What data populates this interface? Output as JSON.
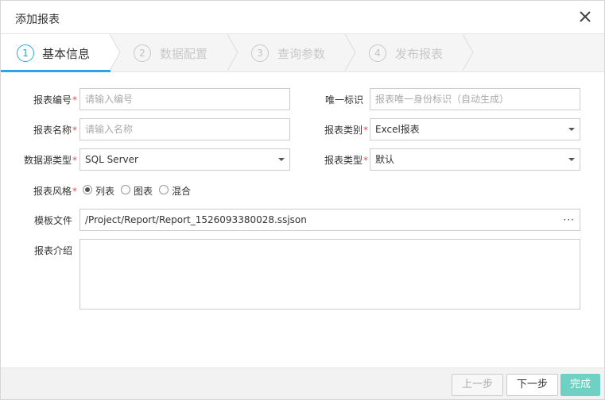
{
  "dialog": {
    "title": "添加报表",
    "close_icon": "close-icon"
  },
  "steps": [
    {
      "num": "1",
      "label": "基本信息",
      "active": true
    },
    {
      "num": "2",
      "label": "数据配置",
      "active": false
    },
    {
      "num": "3",
      "label": "查询参数",
      "active": false
    },
    {
      "num": "4",
      "label": "发布报表",
      "active": false
    }
  ],
  "form": {
    "report_code": {
      "label": "报表编号",
      "required": "*",
      "placeholder": "请输入编号"
    },
    "unique_id": {
      "label": "唯一标识",
      "placeholder": "报表唯一身份标识（自动生成）"
    },
    "report_name": {
      "label": "报表名称",
      "required": "*",
      "placeholder": "请输入名称"
    },
    "report_category": {
      "label": "报表类别",
      "required": "*",
      "value": "Excel报表"
    },
    "datasource_type": {
      "label": "数据源类型",
      "required": "*",
      "value": "SQL Server"
    },
    "report_type": {
      "label": "报表类型",
      "required": "*",
      "value": "默认"
    },
    "report_style": {
      "label": "报表风格",
      "required": "*",
      "options": [
        {
          "label": "列表",
          "checked": true
        },
        {
          "label": "图表",
          "checked": false
        },
        {
          "label": "混合",
          "checked": false
        }
      ]
    },
    "template_file": {
      "label": "模板文件",
      "value": "/Project/Report/Report_1526093380028.ssjson",
      "browse": "···"
    },
    "description": {
      "label": "报表介绍",
      "value": ""
    }
  },
  "footer": {
    "prev": "上一步",
    "next": "下一步",
    "finish": "完成"
  }
}
